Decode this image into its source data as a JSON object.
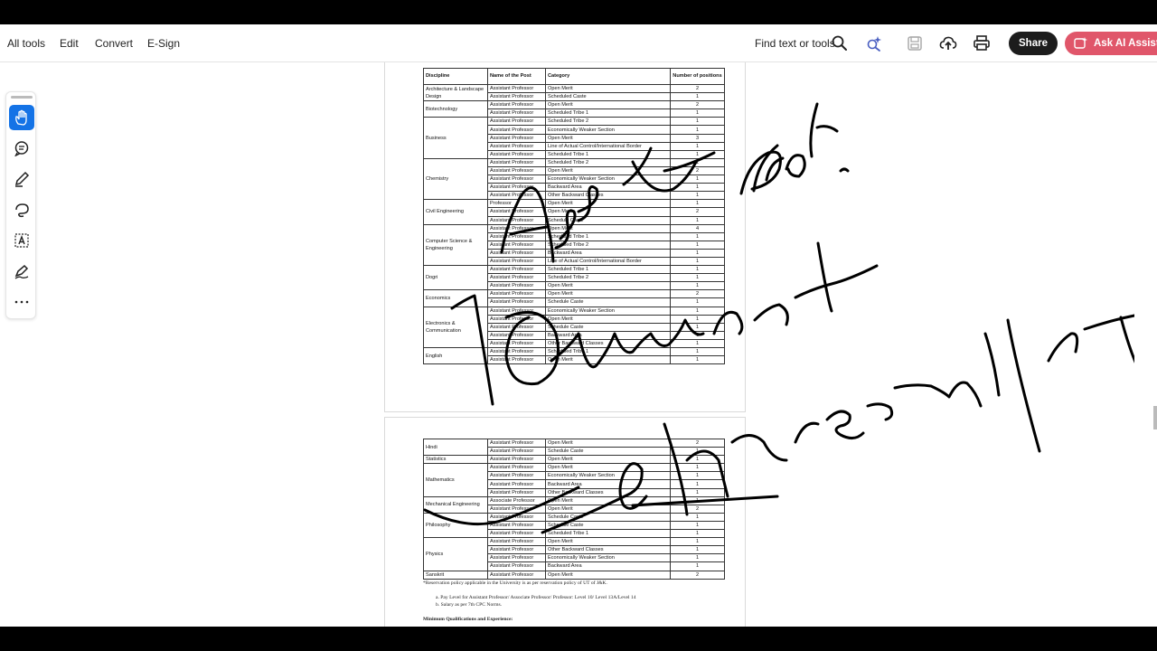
{
  "toolbar": {
    "all_tools": "All tools",
    "edit": "Edit",
    "convert": "Convert",
    "esign": "E-Sign",
    "find_label": "Find text or tools",
    "share_label": "Share",
    "ai_label": "Ask AI Assistant",
    "accent_color": "#e0566a"
  },
  "left_tools": {
    "items": [
      "hand-icon",
      "comment-icon",
      "pen-icon",
      "lasso-icon",
      "text-box-icon",
      "sign-icon",
      "more-icon"
    ]
  },
  "page1": {
    "headers": [
      "Discipline",
      "Name of the Post",
      "Category",
      "Number of positions"
    ],
    "groups": [
      {
        "discipline": "Architecture & Landscape Design",
        "rows": [
          [
            "Assistant Professor",
            "Open Merit",
            "2"
          ],
          [
            "Assistant Professor",
            "Scheduled Caste",
            "1"
          ]
        ]
      },
      {
        "discipline": "Biotechnology",
        "rows": [
          [
            "Assistant Professor",
            "Open Merit",
            "2"
          ],
          [
            "Assistant Professor",
            "Scheduled Tribe 1",
            "1"
          ]
        ]
      },
      {
        "discipline": "Business",
        "rows": [
          [
            "Assistant Professor",
            "Scheduled Tribe 2",
            "1"
          ],
          [
            "Assistant Professor",
            "Economically Weaker Section",
            "1"
          ],
          [
            "Assistant Professor",
            "Open Merit",
            "3"
          ],
          [
            "Assistant Professor",
            "Line of Actual Control/International Border",
            "1"
          ],
          [
            "Assistant Professor",
            "Scheduled Tribe 1",
            "1"
          ]
        ]
      },
      {
        "discipline": "Chemistry",
        "rows": [
          [
            "Assistant Professor",
            "Scheduled Tribe 2",
            "1"
          ],
          [
            "Assistant Professor",
            "Open Merit",
            "2"
          ],
          [
            "Assistant Professor",
            "Economically Weaker Section",
            "1"
          ],
          [
            "Assistant Professor",
            "Backward Area",
            "1"
          ],
          [
            "Assistant Professor",
            "Other Backward Classes",
            "1"
          ]
        ]
      },
      {
        "discipline": "Civil Engineering",
        "rows": [
          [
            "Professor",
            "Open Merit",
            "1"
          ],
          [
            "Assistant Professor",
            "Open Merit",
            "2"
          ],
          [
            "Assistant Professor",
            "Schedule Caste",
            "1"
          ]
        ]
      },
      {
        "discipline": "Computer Science & Engineering",
        "rows": [
          [
            "Assistant Professor",
            "Open Merit",
            "4"
          ],
          [
            "Assistant Professor",
            "Scheduled Tribe 1",
            "1"
          ],
          [
            "Assistant Professor",
            "Scheduled Tribe 2",
            "1"
          ],
          [
            "Assistant Professor",
            "Backward Area",
            "1"
          ],
          [
            "Assistant Professor",
            "Line of Actual Control/International Border",
            "1"
          ]
        ]
      },
      {
        "discipline": "Dogri",
        "rows": [
          [
            "Assistant Professor",
            "Scheduled Tribe 1",
            "1"
          ],
          [
            "Assistant Professor",
            "Scheduled Tribe 2",
            "1"
          ],
          [
            "Assistant Professor",
            "Open Merit",
            "1"
          ]
        ]
      },
      {
        "discipline": "Economics",
        "rows": [
          [
            "Assistant Professor",
            "Open Merit",
            "2"
          ],
          [
            "Assistant Professor",
            "Schedule Caste",
            "1"
          ]
        ]
      },
      {
        "discipline": "Electronics & Communication",
        "rows": [
          [
            "Assistant Professor",
            "Economically Weaker Section",
            "1"
          ],
          [
            "Assistant Professor",
            "Open Merit",
            "1"
          ],
          [
            "Assistant Professor",
            "Schedule Caste",
            "1"
          ],
          [
            "Assistant Professor",
            "Backward Area",
            "1"
          ],
          [
            "Assistant Professor",
            "Other Backward Classes",
            "1"
          ]
        ]
      },
      {
        "discipline": "English",
        "rows": [
          [
            "Assistant Professor",
            "Scheduled Tribe 1",
            "1"
          ],
          [
            "Assistant Professor",
            "Open Merit",
            "1"
          ]
        ]
      }
    ]
  },
  "page2": {
    "groups": [
      {
        "discipline": "Hindi",
        "rows": [
          [
            "Assistant Professor",
            "Open Merit",
            "2"
          ],
          [
            "Assistant Professor",
            "Schedule Caste",
            "1"
          ]
        ]
      },
      {
        "discipline": "Statistics",
        "rows": [
          [
            "Assistant Professor",
            "Open Merit",
            "1"
          ]
        ]
      },
      {
        "discipline": "Mathematics",
        "rows": [
          [
            "Assistant Professor",
            "Open Merit",
            "1"
          ],
          [
            "Assistant Professor",
            "Economically Weaker Section",
            "1"
          ],
          [
            "Assistant Professor",
            "Backward Area",
            "1"
          ],
          [
            "Assistant Professor",
            "Other Backward Classes",
            "1"
          ]
        ]
      },
      {
        "discipline": "Mechanical Engineering",
        "rows": [
          [
            "Associate Professor",
            "Open Merit",
            "1"
          ],
          [
            "Assistant Professor",
            "Open Merit",
            "2"
          ]
        ]
      },
      {
        "discipline": "Philosophy",
        "rows": [
          [
            "Assistant Professor",
            "Schedule Caste",
            "1"
          ],
          [
            "Assistant Professor",
            "Schedule Caste",
            "1"
          ],
          [
            "Assistant Professor",
            "Scheduled Tribe 1",
            "1"
          ]
        ]
      },
      {
        "discipline": "Physics",
        "rows": [
          [
            "Assistant Professor",
            "Open Merit",
            "1"
          ],
          [
            "Assistant Professor",
            "Other Backward Classes",
            "1"
          ],
          [
            "Assistant Professor",
            "Economically Weaker Section",
            "1"
          ],
          [
            "Assistant Professor",
            "Backward Area",
            "1"
          ]
        ]
      },
      {
        "discipline": "Sanskrit",
        "rows": [
          [
            "Assistant Professor",
            "Open Merit",
            "2"
          ]
        ]
      }
    ],
    "footnote": "*Reservation policy applicable in the University is as per reservation policy of UT of J&K.",
    "item_a": "a.    Pay Level for Assistant Professor/ Associate Professor/ Professor: Level 10/ Level 13A/Level 14",
    "item_b": "b.    Salary as per 7th CPC Norms.",
    "section_heading": "Minimum Qualifications and Experience:"
  }
}
